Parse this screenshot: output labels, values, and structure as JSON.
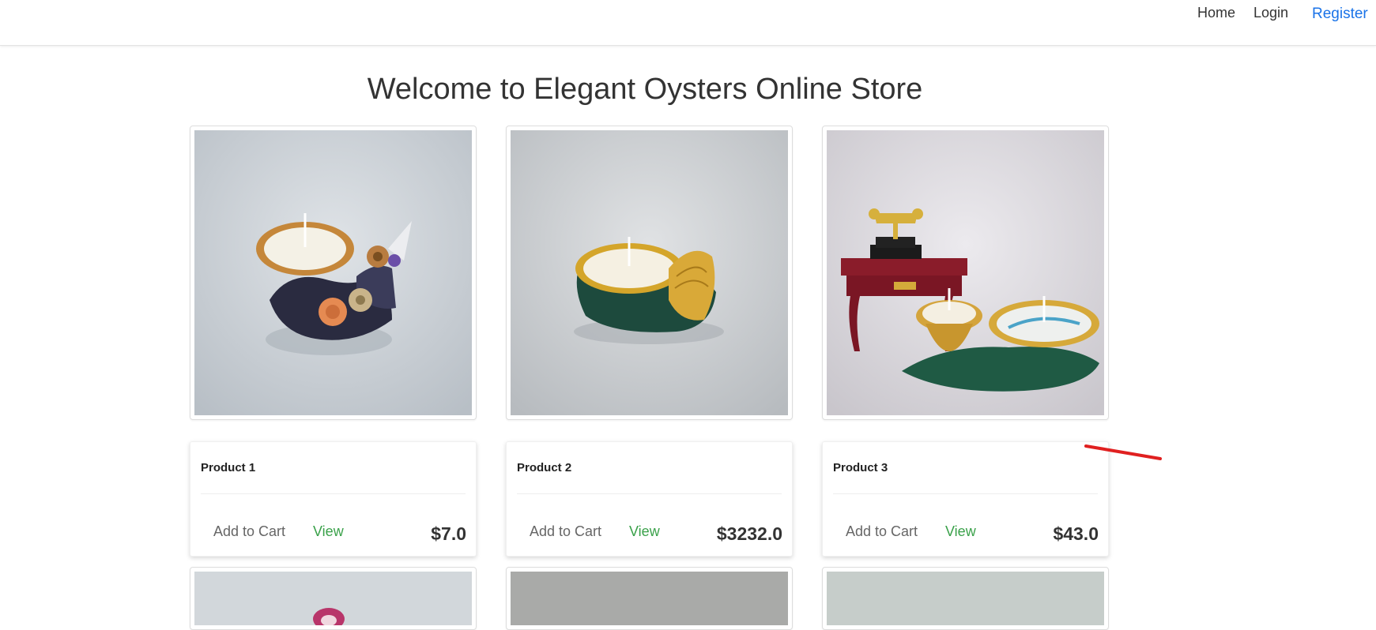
{
  "nav": {
    "home": "Home",
    "login": "Login",
    "register": "Register"
  },
  "page": {
    "title": "Welcome to Elegant Oysters Online Store"
  },
  "products": [
    {
      "name": "Product 1",
      "add_to_cart": "Add to Cart",
      "view": "View",
      "price": "$7.0"
    },
    {
      "name": "Product 2",
      "add_to_cart": "Add to Cart",
      "view": "View",
      "price": "$3232.0"
    },
    {
      "name": "Product 3",
      "add_to_cart": "Add to Cart",
      "view": "View",
      "price": "$43.0"
    }
  ],
  "colors": {
    "link_accent": "#1a73e8",
    "view_link": "#3aa14a",
    "annotation_mark": "#e02020"
  }
}
